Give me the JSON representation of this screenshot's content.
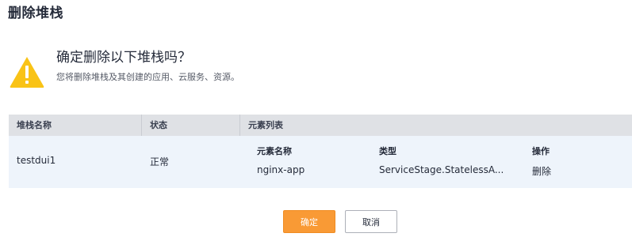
{
  "dialog": {
    "title": "删除堆栈",
    "heading": "确定删除以下堆栈吗？",
    "description": "您将删除堆栈及其创建的应用、云服务、资源。",
    "warning_color": "#f9c316"
  },
  "table": {
    "columns": [
      "堆栈名称",
      "状态",
      "元素列表"
    ],
    "rows": [
      {
        "name": "testdui1",
        "status": "正常",
        "elements": {
          "columns": [
            "元素名称",
            "类型",
            "操作"
          ],
          "items": [
            {
              "name": "nginx-app",
              "type": "ServiceStage.StatelessA...",
              "action": "删除"
            }
          ]
        }
      }
    ]
  },
  "buttons": {
    "ok": "确定",
    "cancel": "取消"
  },
  "colors": {
    "primary": "#f99a35",
    "header_bg": "#dfe1e5",
    "row_bg": "#eef4fb"
  }
}
